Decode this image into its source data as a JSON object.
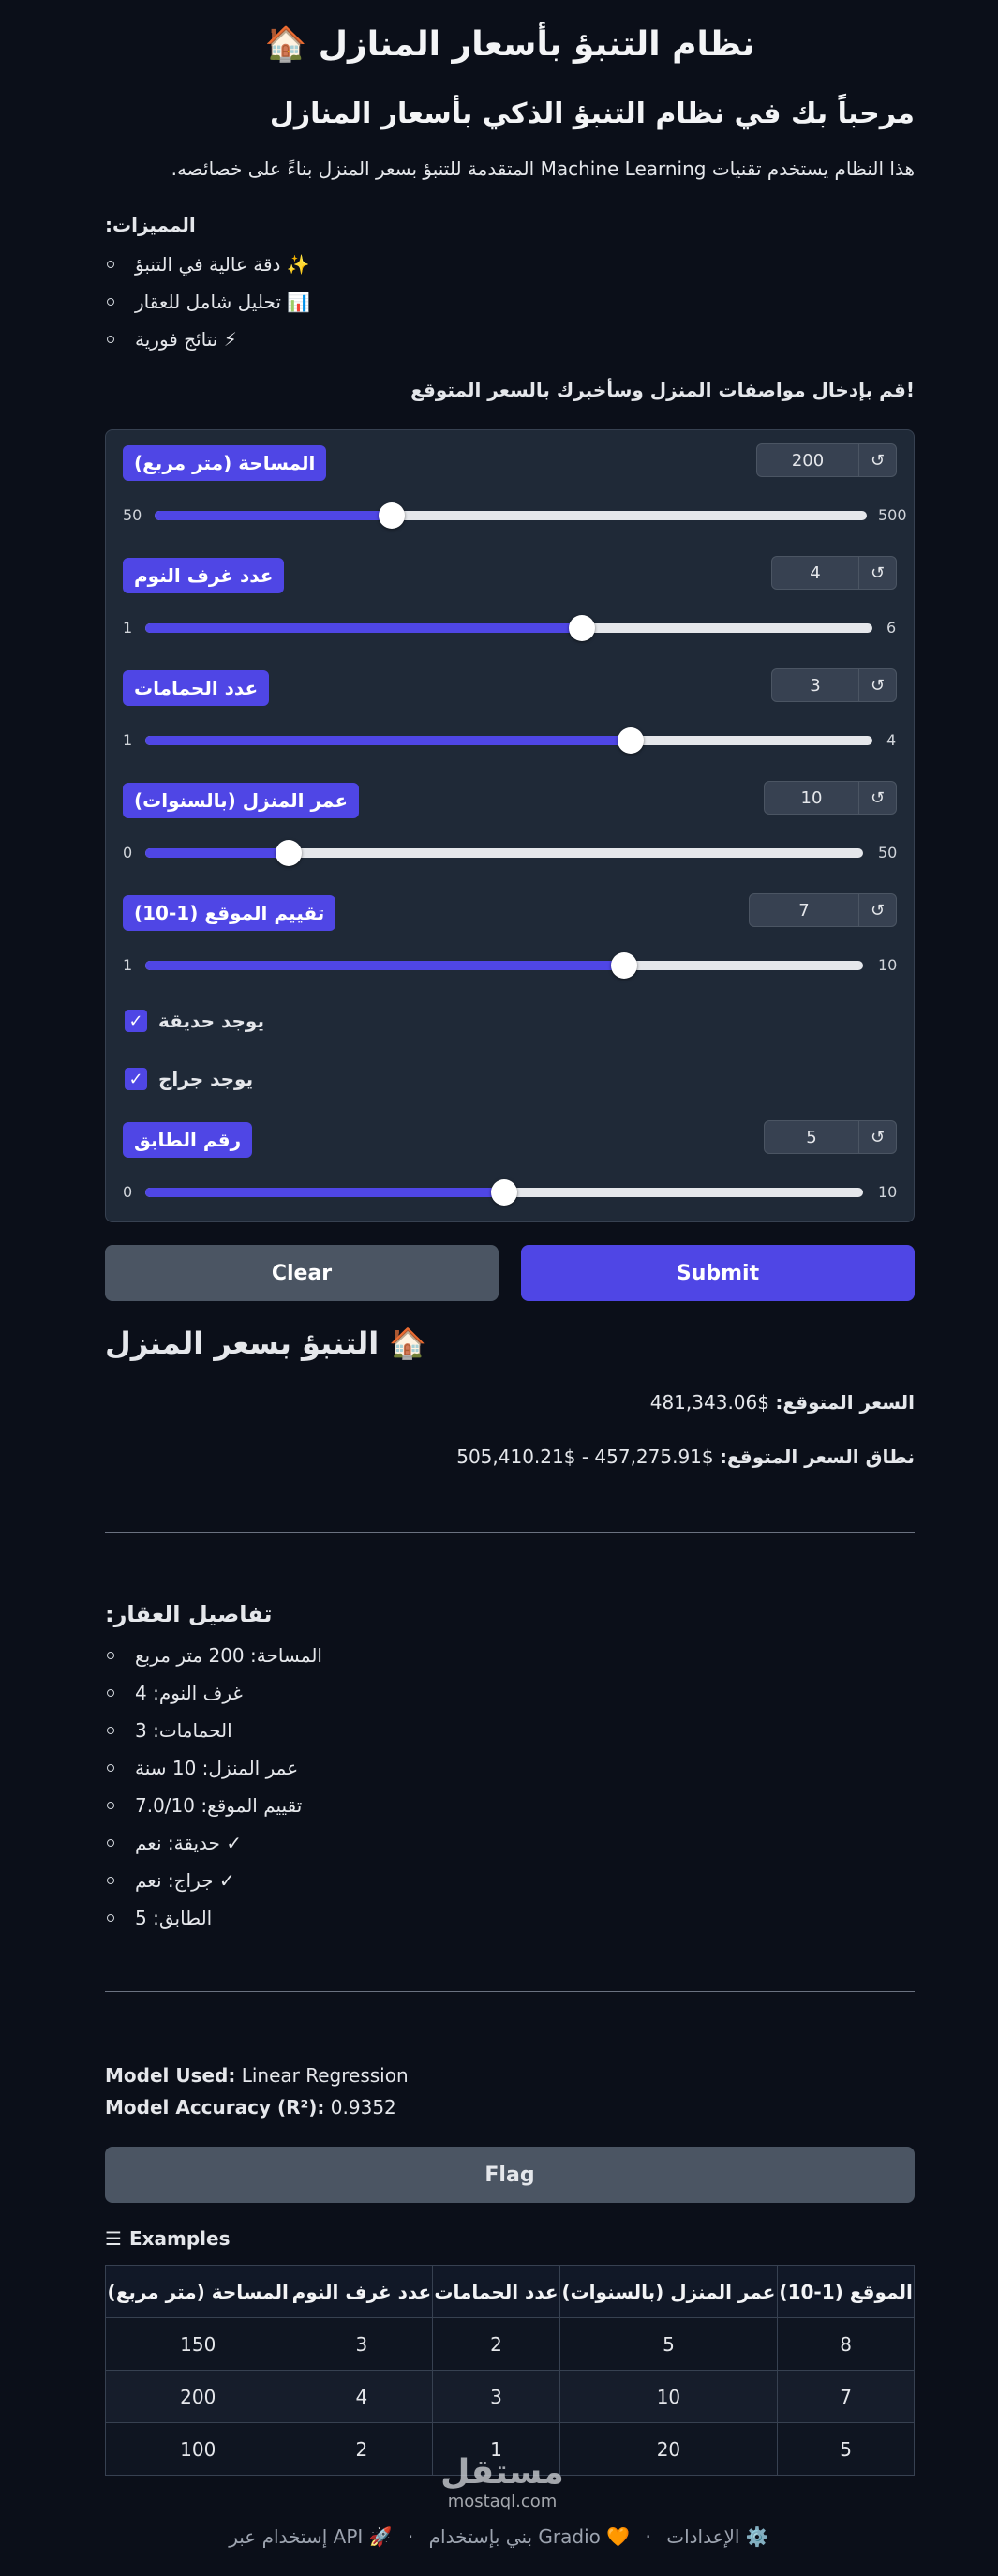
{
  "app": {
    "title": "نظام التنبؤ بأسعار المنازل 🏠",
    "welcome": "مرحباً بك في نظام التنبؤ الذكي بأسعار المنازل",
    "description": "هذا النظام يستخدم تقنيات Machine Learning المتقدمة للتنبؤ بسعر المنزل بناءً على خصائصه.",
    "features_title": ":المميزات",
    "features": [
      "دقة عالية في التنبؤ ✨",
      "تحليل شامل للعقار 📊",
      "نتائج فورية ⚡"
    ],
    "cta": "!قم بإدخال مواصفات المنزل وسأخبرك بالسعر المتوقع"
  },
  "inputs": {
    "reset_icon": "↺",
    "sliders": [
      {
        "label": "المساحة (متر مربع)",
        "value": "200",
        "min": "50",
        "max": "500",
        "fraction": 0.333
      },
      {
        "label": "عدد غرف النوم",
        "value": "4",
        "min": "1",
        "max": "6",
        "fraction": 0.6
      },
      {
        "label": "عدد الحمامات",
        "value": "3",
        "min": "1",
        "max": "4",
        "fraction": 0.667
      },
      {
        "label": "عمر المنزل (بالسنوات)",
        "value": "10",
        "min": "0",
        "max": "50",
        "fraction": 0.2
      },
      {
        "label": "تقييم الموقع (1-10)",
        "value": "7",
        "min": "1",
        "max": "10",
        "fraction": 0.667
      },
      {
        "label": "رقم الطابق",
        "value": "5",
        "min": "0",
        "max": "10",
        "fraction": 0.5
      }
    ],
    "checkboxes": [
      {
        "label": "يوجد حديقة",
        "checked": true
      },
      {
        "label": "يوجد جراج",
        "checked": true
      }
    ]
  },
  "buttons": {
    "clear": "Clear",
    "submit": "Submit",
    "flag": "Flag"
  },
  "result": {
    "title": "التنبؤ بسعر المنزل 🏠",
    "price_label": "السعر المتوقع:",
    "price_value": "$481,343.06",
    "range_label": "نطاق السعر المتوقع:",
    "range_value": "$457,275.91 - $505,410.21"
  },
  "details": {
    "title": ":تفاصيل العقار",
    "items": [
      "المساحة: 200 متر مربع",
      "غرف النوم: 4",
      "الحمامات: 3",
      "عمر المنزل: 10 سنة",
      "تقييم الموقع: 7.0/10",
      "حديقة: نعم ✓",
      "جراج: نعم ✓",
      "الطابق: 5"
    ]
  },
  "model": {
    "used_label": "Model Used:",
    "used_value": "Linear Regression",
    "acc_label": "Model Accuracy (R²):",
    "acc_value": "0.9352"
  },
  "examples": {
    "title": "Examples",
    "headers": [
      "المساحة (متر مربع)",
      "عدد غرف النوم",
      "عدد الحمامات",
      "عمر المنزل (بالسنوات)",
      "الموقع (1-10)"
    ],
    "rows": [
      [
        "150",
        "3",
        "2",
        "5",
        "8"
      ],
      [
        "200",
        "4",
        "3",
        "10",
        "7"
      ],
      [
        "100",
        "2",
        "1",
        "20",
        "5"
      ]
    ]
  },
  "footer": {
    "api": "إستخدام عبر API 🚀",
    "gradio": "بني بإستخدام Gradio 🧡",
    "settings": "الإعدادات ⚙️",
    "sep": "·"
  },
  "watermark": {
    "arabic": "مستقل",
    "latin": "mostaql.com"
  },
  "colors": {
    "accent": "#4f46e5",
    "background": "#0b0f19",
    "panel": "#1f2937"
  }
}
